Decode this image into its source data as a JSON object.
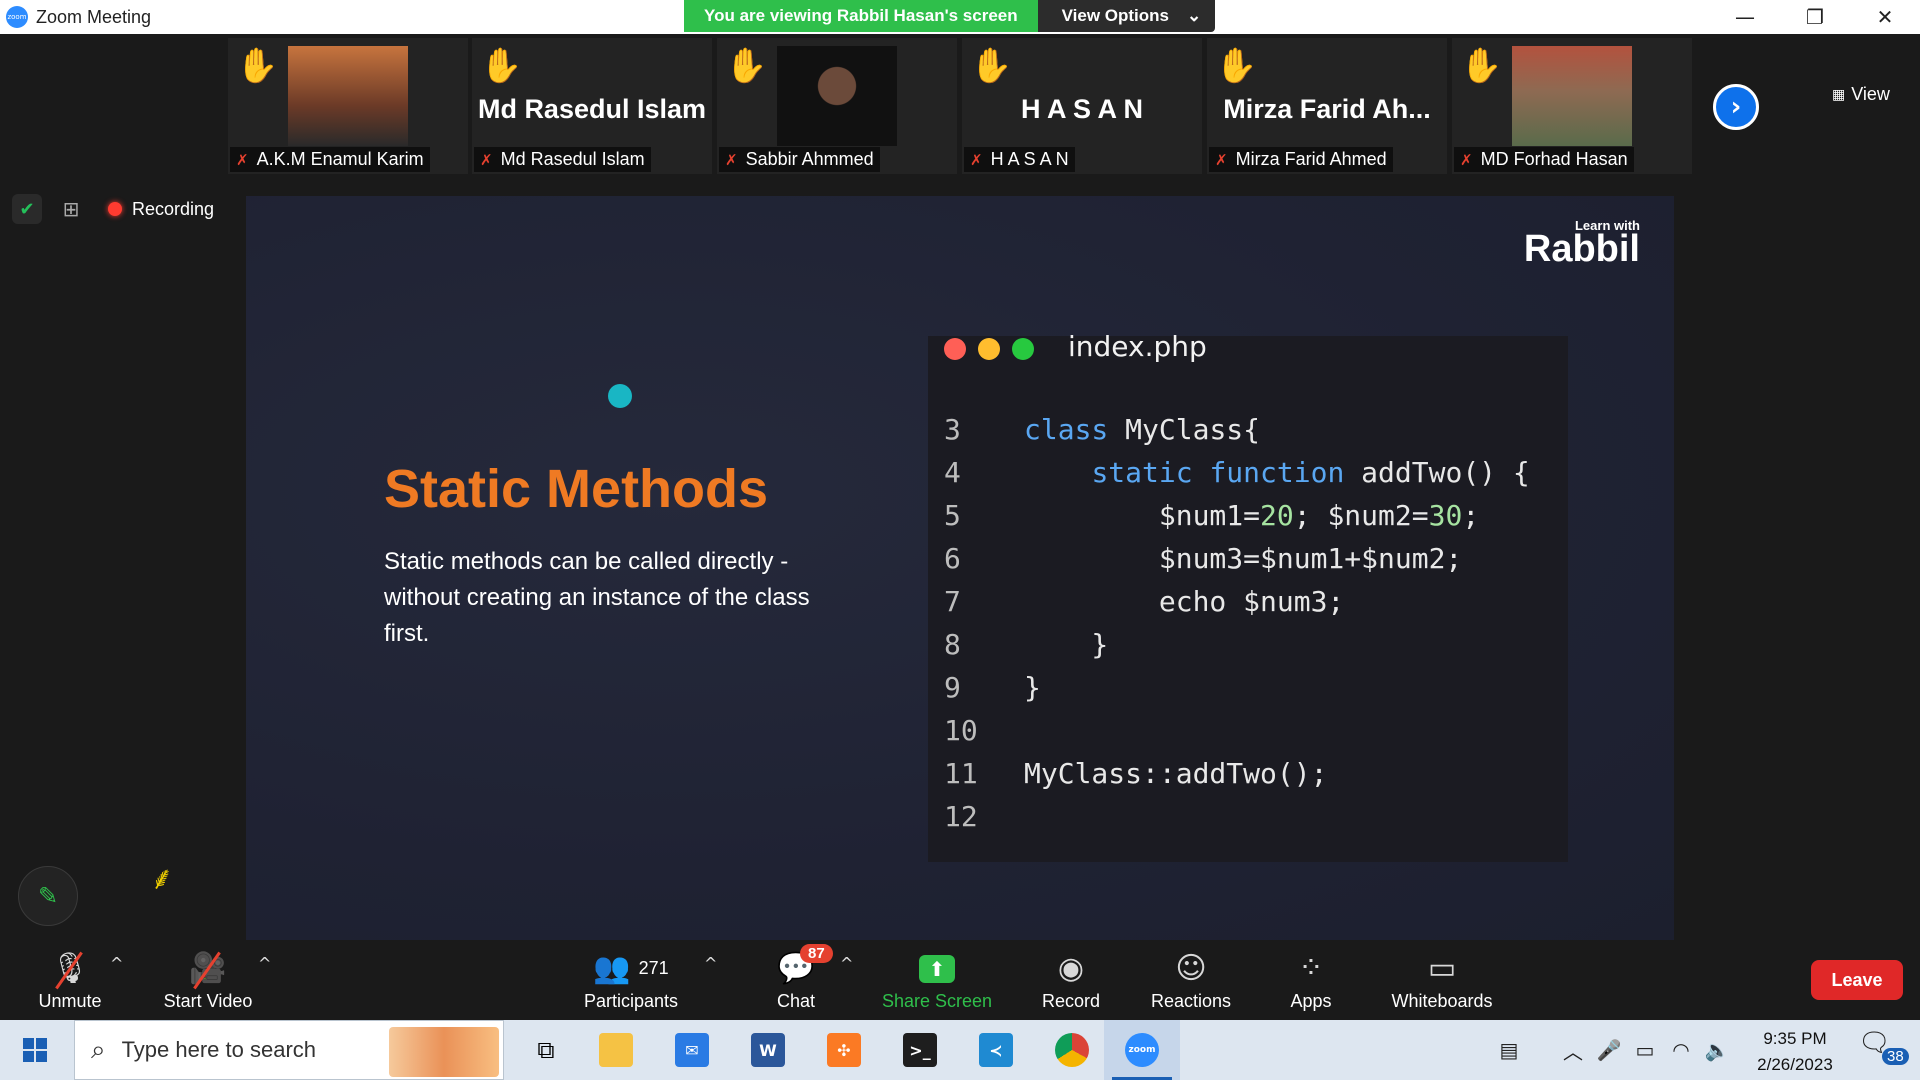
{
  "window": {
    "logo_text": "zoom",
    "title": "Zoom Meeting",
    "controls": {
      "minimize": "—",
      "restore": "❐",
      "close": "✕"
    }
  },
  "banner": {
    "viewing_text": "You are viewing Rabbil Hasan's screen",
    "view_options": "View Options",
    "caret": "⌄"
  },
  "gallery": {
    "participants": [
      {
        "name": "A.K.M Enamul Karim",
        "display": "",
        "has_photo": true,
        "photo_color": "#8a4a2e"
      },
      {
        "name": "Md Rasedul Islam",
        "display": "Md Rasedul Islam",
        "has_photo": false
      },
      {
        "name": "Sabbir Ahmmed",
        "display": "",
        "has_photo": true,
        "photo_color": "#e9e3df"
      },
      {
        "name": "H A S A N",
        "display": "H A S A N",
        "has_photo": false
      },
      {
        "name": "Mirza Farid Ahmed",
        "display": "Mirza Farid Ah...",
        "has_photo": false
      },
      {
        "name": "MD Forhad Hasan",
        "display": "",
        "has_photo": true,
        "photo_color": "#7b5a4a"
      }
    ],
    "hand_icon": "✋",
    "mute_icon": "🎤",
    "next_icon": "›",
    "view_label": "View"
  },
  "status": {
    "recording_label": "Recording"
  },
  "slide": {
    "brand_small": "Learn with",
    "brand_big": "Rabbil",
    "title": "Static Methods",
    "body": "Static methods can be called directly - without creating an instance of the class first.",
    "code_filename": "index.php",
    "code_lines": [
      {
        "n": "3",
        "text": "class MyClass{"
      },
      {
        "n": "4",
        "text": "    static function addTwo() {"
      },
      {
        "n": "5",
        "text": "        $num1=20; $num2=30;"
      },
      {
        "n": "6",
        "text": "        $num3=$num1+$num2;"
      },
      {
        "n": "7",
        "text": "        echo $num3;"
      },
      {
        "n": "8",
        "text": "    }"
      },
      {
        "n": "9",
        "text": "}"
      },
      {
        "n": "10",
        "text": ""
      },
      {
        "n": "11",
        "text": "MyClass::addTwo();"
      },
      {
        "n": "12",
        "text": ""
      }
    ],
    "colors": {
      "title": "#ef7a23",
      "keyword": "#5aa7f2",
      "number": "#a6e3a1"
    }
  },
  "toolbar": {
    "unmute": "Unmute",
    "start_video": "Start Video",
    "participants": "Participants",
    "participants_count": "271",
    "chat": "Chat",
    "chat_badge": "87",
    "share_screen": "Share Screen",
    "record": "Record",
    "reactions": "Reactions",
    "apps": "Apps",
    "whiteboards": "Whiteboards",
    "leave": "Leave",
    "caret": "^"
  },
  "taskbar": {
    "search_placeholder": "Type here to search",
    "apps": [
      "task-view",
      "file-explorer",
      "mail",
      "word",
      "xampp",
      "terminal",
      "vscode",
      "chrome",
      "zoom"
    ],
    "word_letter": "W",
    "zoom_letter": "zoom",
    "time": "9:35 PM",
    "date": "2/26/2023",
    "notification_count": "38"
  }
}
